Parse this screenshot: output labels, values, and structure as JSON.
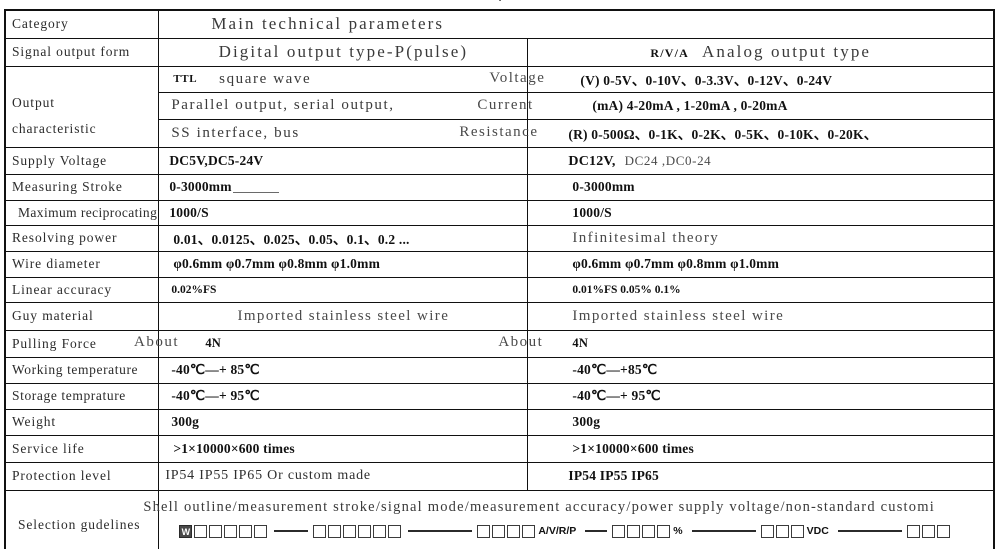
{
  "caption_fragment": "·",
  "table": {
    "col_headers": {
      "category_label": "Category",
      "main_params": "Main technical parameters"
    },
    "signal_row": {
      "label": "Signal output form",
      "digital": "Digital output type-P(pulse)",
      "analog_prefix": "R/V/A",
      "analog": "Analog output type"
    },
    "output_characteristic": {
      "label_line1": "Output",
      "label_line2": "characteristic",
      "digital_lines": [
        "square wave",
        "Parallel output, serial output,",
        "SS interface, bus"
      ],
      "ttl_prefix": "TTL",
      "float_labels": {
        "voltage": "Voltage",
        "current": "Current",
        "resistance": "Resistance"
      },
      "analog_lines": [
        "(V) 0-5V、0-10V、0-3.3V、0-12V、0-24V",
        "(mA) 4-20mA , 1-20mA , 0-20mA",
        "(R) 0-500Ω、0-1K、0-2K、0-5K、0-10K、0-20K、"
      ]
    },
    "rows": [
      {
        "label": "Supply Voltage",
        "digital": "DC5V,DC5-24V",
        "analog_bold": "DC12V,",
        "analog_light": "DC24 ,DC0-24",
        "digital_style": "val",
        "analog_style": "mixed"
      },
      {
        "label": "Measuring Stroke",
        "digital": "0-3000mm",
        "analog": "0-3000mm",
        "digital_style": "val-underline",
        "analog_style": "val"
      },
      {
        "label": "Maximum reciprocating",
        "digital": "1000/S",
        "analog": "1000/S",
        "digital_style": "val",
        "analog_style": "val"
      },
      {
        "label": "Resolving power",
        "digital": "0.01、0.0125、0.025、0.05、0.1、0.2  ...",
        "analog": "Infinitesimal theory",
        "digital_style": "val",
        "analog_style": "ghost"
      },
      {
        "label": "Wire diameter",
        "digital": "φ0.6mm   φ0.7mm   φ0.8mm   φ1.0mm",
        "analog": "φ0.6mm   φ0.7mm   φ0.8mm   φ1.0mm",
        "digital_style": "val",
        "analog_style": "val"
      },
      {
        "label": "Linear accuracy",
        "digital": "0.02%FS",
        "analog": "0.01%FS  0.05%  0.1%",
        "digital_style": "small",
        "analog_style": "small"
      },
      {
        "label": "Guy material",
        "digital": "Imported stainless steel wire",
        "analog": "Imported stainless steel wire",
        "digital_style": "ghost-center",
        "analog_style": "ghost"
      },
      {
        "label": "Pulling Force",
        "digital_float": "About",
        "digital": "4N",
        "analog_float": "About",
        "analog": "4N",
        "digital_style": "float-about",
        "analog_style": "float-about"
      },
      {
        "label": "Working temperature",
        "digital": "-40℃—+ 85℃",
        "analog": "-40℃—+85℃",
        "digital_style": "val",
        "analog_style": "val"
      },
      {
        "label": "Storage temprature",
        "digital": "-40℃—+ 95℃",
        "analog": "-40℃—+ 95℃",
        "digital_style": "val",
        "analog_style": "val"
      },
      {
        "label": "Weight",
        "digital": "300g",
        "analog": "300g",
        "digital_style": "val",
        "analog_style": "val"
      },
      {
        "label": "Service life",
        "digital": ">1×10000×600   times",
        "analog": ">1×10000×600 times",
        "digital_style": "val",
        "analog_style": "val"
      },
      {
        "label": "Protection level",
        "digital": "IP54 IP55  IP65  Or custom made",
        "analog": "IP54  IP55   IP65",
        "digital_style": "mixed-ip",
        "analog_style": "val"
      }
    ],
    "selection": {
      "label": "Selection gudelines",
      "text": "Shell outline/measurement stroke/signal mode/measurement accuracy/power supply voltage/non-standard customi",
      "code": {
        "prefix_letter": "W",
        "group1_boxes": 5,
        "group2_boxes": 6,
        "group3_boxes": 4,
        "group3_unit": "A/V/R/P",
        "group4_boxes": 4,
        "group4_unit": "%",
        "group5_boxes": 3,
        "group5_unit": "VDC",
        "group6_boxes": 3
      }
    }
  },
  "colors": {
    "border": "#111111",
    "text_dark": "#111111",
    "text_gray": "#3a3a3a",
    "box_fill": "#4a4a4a"
  }
}
